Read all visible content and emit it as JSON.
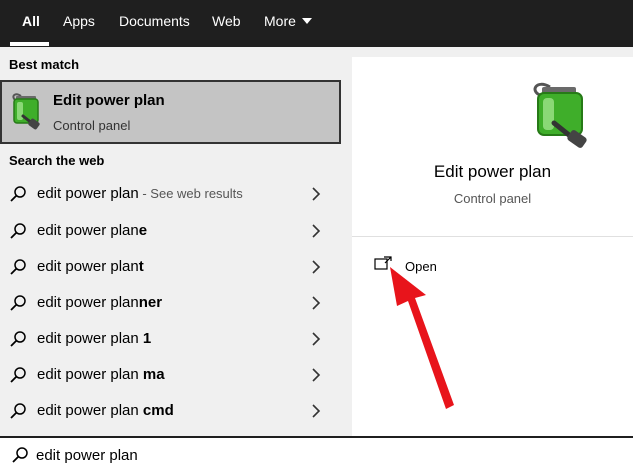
{
  "tabs": [
    {
      "label": "All",
      "active": true
    },
    {
      "label": "Apps"
    },
    {
      "label": "Documents"
    },
    {
      "label": "Web"
    },
    {
      "label": "More"
    }
  ],
  "left": {
    "best_match_heading": "Best match",
    "best_match": {
      "title": "Edit power plan",
      "subtitle": "Control panel",
      "icon": "power-plan-icon"
    },
    "web_heading": "Search the web",
    "web_results": [
      {
        "prefix": "edit power plan",
        "bold": "",
        "hint": " - See web results"
      },
      {
        "prefix": "edit power plan",
        "bold": "e",
        "hint": ""
      },
      {
        "prefix": "edit power plan",
        "bold": "t",
        "hint": ""
      },
      {
        "prefix": "edit power plan",
        "bold": "ner",
        "hint": ""
      },
      {
        "prefix": "edit power plan ",
        "bold": "1",
        "hint": ""
      },
      {
        "prefix": "edit power plan ",
        "bold": "ma",
        "hint": ""
      },
      {
        "prefix": "edit power plan ",
        "bold": "cmd",
        "hint": ""
      }
    ]
  },
  "right": {
    "title": "Edit power plan",
    "subtitle": "Control panel",
    "open_label": "Open"
  },
  "search": {
    "value": "edit power plan"
  },
  "colors": {
    "topbar": "#1f1f1f",
    "selected_bg": "#c4c4c4",
    "pane_bg": "#f0f0f0",
    "arrow": "#e8141b",
    "battery_green": "#3fae2a"
  }
}
